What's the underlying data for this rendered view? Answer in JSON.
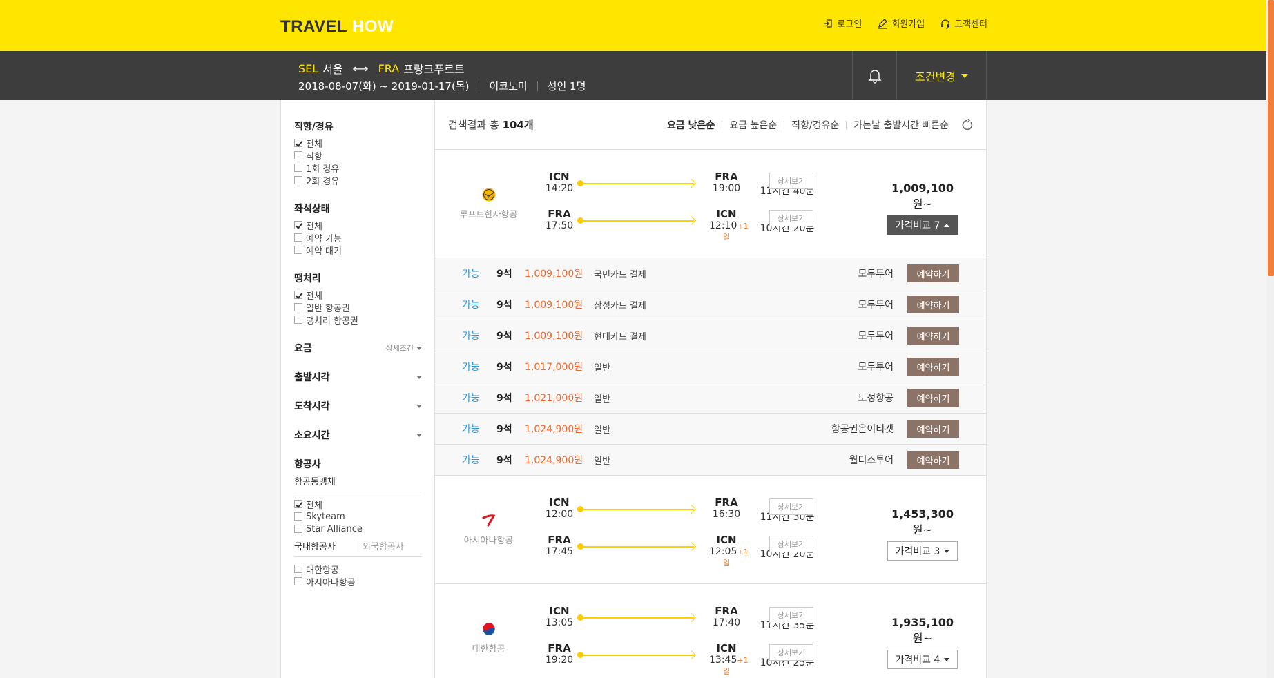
{
  "header": {
    "logo_a": "TRAVEL",
    "logo_b": "HOW",
    "links": [
      {
        "label": "로그인",
        "icon": "login-icon"
      },
      {
        "label": "회원가입",
        "icon": "pencil-icon"
      },
      {
        "label": "고객센터",
        "icon": "headset-icon"
      }
    ]
  },
  "search": {
    "from_code": "SEL",
    "from_name": "서울",
    "to_code": "FRA",
    "to_name": "프랑크푸르트",
    "arrow": "⟷",
    "dates": "2018-08-07(화) ~ 2019-01-17(목)",
    "cabin": "이코노미",
    "passengers": "성인 1명",
    "change_label": "조건변경"
  },
  "filters": {
    "direct": {
      "title": "직항/경유",
      "options": [
        {
          "label": "전체",
          "checked": true
        },
        {
          "label": "직항",
          "checked": false
        },
        {
          "label": "1회 경유",
          "checked": false
        },
        {
          "label": "2회 경유",
          "checked": false
        }
      ]
    },
    "seat": {
      "title": "좌석상태",
      "options": [
        {
          "label": "전체",
          "checked": true
        },
        {
          "label": "예약 가능",
          "checked": false
        },
        {
          "label": "예약 대기",
          "checked": false
        }
      ]
    },
    "deal": {
      "title": "땡처리",
      "options": [
        {
          "label": "전체",
          "checked": true
        },
        {
          "label": "일반 항공권",
          "checked": false
        },
        {
          "label": "땡처리 항공권",
          "checked": false
        }
      ]
    },
    "fare": {
      "title": "요금",
      "more": "상세조건"
    },
    "dep_time": {
      "title": "출발시각"
    },
    "arr_time": {
      "title": "도착시각"
    },
    "duration": {
      "title": "소요시간"
    },
    "airline": {
      "title": "항공사",
      "alliance_title": "항공동맹체",
      "alliance_options": [
        {
          "label": "전체",
          "checked": true
        },
        {
          "label": "Skyteam",
          "checked": false
        },
        {
          "label": "Star Alliance",
          "checked": false
        }
      ],
      "tab_domestic": "국내항공사",
      "tab_foreign": "외국항공사",
      "domestic_options": [
        {
          "label": "대한항공",
          "checked": false
        },
        {
          "label": "아시아나항공",
          "checked": false
        }
      ]
    }
  },
  "results": {
    "count_prefix": "검색결과 총",
    "count": "104개",
    "sorts": [
      "요금 낮은순",
      "요금 높은순",
      "직항/경유순",
      "가는날 출발시간 빠른순"
    ],
    "detail_label": "상세보기",
    "book_label": "예약하기",
    "cards": [
      {
        "airline": "루프트한자항공",
        "out": {
          "dep": "ICN",
          "dep_time": "14:20",
          "arr": "FRA",
          "arr_time": "19:00",
          "plus": "",
          "type": "직항",
          "dur": "11시간 40분"
        },
        "ret": {
          "dep": "FRA",
          "dep_time": "17:50",
          "arr": "ICN",
          "arr_time": "12:10",
          "plus": "+1일",
          "type": "직항",
          "dur": "10시간 20분"
        },
        "price": "1,009,100",
        "won": "원~",
        "compare": "가격비교 7",
        "expanded": true
      },
      {
        "airline": "아시아나항공",
        "out": {
          "dep": "ICN",
          "dep_time": "12:00",
          "arr": "FRA",
          "arr_time": "16:30",
          "plus": "",
          "type": "직항",
          "dur": "11시간 30분"
        },
        "ret": {
          "dep": "FRA",
          "dep_time": "17:45",
          "arr": "ICN",
          "arr_time": "12:05",
          "plus": "+1일",
          "type": "직항",
          "dur": "10시간 20분"
        },
        "price": "1,453,300",
        "won": "원~",
        "compare": "가격비교 3",
        "expanded": false
      },
      {
        "airline": "대한항공",
        "out": {
          "dep": "ICN",
          "dep_time": "13:05",
          "arr": "FRA",
          "arr_time": "17:40",
          "plus": "",
          "type": "직항",
          "dur": "11시간 35분"
        },
        "ret": {
          "dep": "FRA",
          "dep_time": "19:20",
          "arr": "ICN",
          "arr_time": "13:45",
          "plus": "+1일",
          "type": "직항",
          "dur": "10시간 25분"
        },
        "price": "1,935,100",
        "won": "원~",
        "compare": "가격비교 4",
        "expanded": false
      }
    ],
    "offers": [
      {
        "avail": "가능",
        "seats": "9석",
        "price": "1,009,100원",
        "method": "국민카드 결제",
        "agent": "모두투어"
      },
      {
        "avail": "가능",
        "seats": "9석",
        "price": "1,009,100원",
        "method": "삼성카드 결제",
        "agent": "모두투어"
      },
      {
        "avail": "가능",
        "seats": "9석",
        "price": "1,009,100원",
        "method": "현대카드 결제",
        "agent": "모두투어"
      },
      {
        "avail": "가능",
        "seats": "9석",
        "price": "1,017,000원",
        "method": "일반",
        "agent": "모두투어"
      },
      {
        "avail": "가능",
        "seats": "9석",
        "price": "1,021,000원",
        "method": "일반",
        "agent": "토성항공"
      },
      {
        "avail": "가능",
        "seats": "9석",
        "price": "1,024,900원",
        "method": "일반",
        "agent": "항공권은이티켓"
      },
      {
        "avail": "가능",
        "seats": "9석",
        "price": "1,024,900원",
        "method": "일반",
        "agent": "월디스투어"
      }
    ]
  },
  "colors": {
    "brand_yellow": "#ffe600",
    "dark_bar": "#3d3d3d",
    "accent_orange": "#f0692c",
    "available_blue": "#2b9be0",
    "book_brown": "#8b7467"
  }
}
